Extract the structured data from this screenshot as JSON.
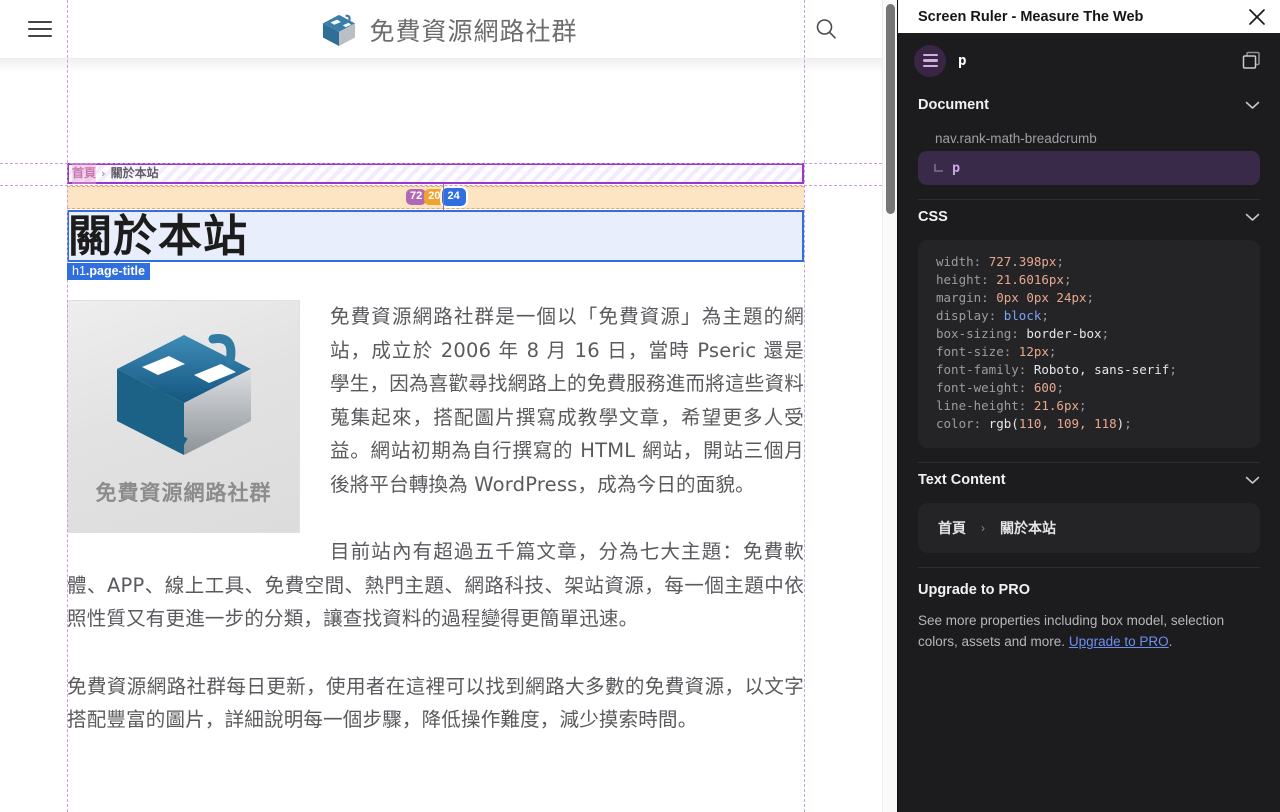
{
  "webpage": {
    "header": {
      "menu_icon": "hamburger-icon",
      "brand_text": "免費資源網路社群",
      "search_icon": "search-icon"
    },
    "breadcrumb": {
      "home": "首頁",
      "separator": "›",
      "current": "關於本站"
    },
    "measurements": {
      "purple": "72",
      "orange": "20",
      "blue": "24"
    },
    "title": "關於本站",
    "element_tag": {
      "tag": "h1",
      "class": ".page-title"
    },
    "logo_caption": "免費資源網路社群",
    "paragraphs": [
      "免費資源網路社群是一個以「免費資源」為主題的網站，成立於 2006 年 8 月 16 日，當時 Pseric 還是學生，因為喜歡尋找網路上的免費服務進而將這些資料蒐集起來，搭配圖片撰寫成教學文章，希望更多人受益。網站初期為自行撰寫的 HTML 網站，開站三個月後將平台轉換為 WordPress，成為今日的面貌。",
      "目前站內有超過五千篇文章，分為七大主題：免費軟體、APP、線上工具、免費空間、熱門主題、網路科技、架站資源，每一個主題中依照性質又有更進一步的分類，讓查找資料的過程變得更簡單迅速。",
      "免費資源網路社群每日更新，使用者在這裡可以找到網路大多數的免費資源，以文字搭配豐富的圖片，詳細說明每一個步驟，降低操作難度，減少摸索時間。"
    ]
  },
  "panel": {
    "title": "Screen Ruler - Measure The Web",
    "close_icon": "close-icon",
    "toolbar": {
      "avatar_icon": "menu-avatar-icon",
      "selected_element": "p",
      "copy_icon": "copy-icon"
    },
    "document": {
      "heading": "Document",
      "chevron_icon": "chevron-down-icon",
      "parent_node": "nav.rank-math-breadcrumb",
      "selected_node": "p"
    },
    "css": {
      "heading": "CSS",
      "chevron_icon": "chevron-down-icon",
      "properties": [
        {
          "name": "width",
          "value": "727.398px",
          "kind": "num"
        },
        {
          "name": "height",
          "value": "21.6016px",
          "kind": "num"
        },
        {
          "name": "margin",
          "value": "0px 0px 24px",
          "kind": "num"
        },
        {
          "name": "display",
          "value": "block",
          "kind": "kw"
        },
        {
          "name": "box-sizing",
          "value": "border-box",
          "kind": "word"
        },
        {
          "name": "font-size",
          "value": "12px",
          "kind": "num"
        },
        {
          "name": "font-family",
          "value": "Roboto, sans-serif",
          "kind": "word"
        },
        {
          "name": "font-weight",
          "value": "600",
          "kind": "num"
        },
        {
          "name": "line-height",
          "value": "21.6px",
          "kind": "num"
        },
        {
          "name": "color",
          "value": "rgb(110, 109, 118)",
          "kind": "func"
        }
      ]
    },
    "text_content": {
      "heading": "Text Content",
      "chevron_icon": "chevron-down-icon",
      "value_home": "首頁",
      "value_sep": "›",
      "value_current": "關於本站"
    },
    "upgrade": {
      "heading": "Upgrade to PRO",
      "body_before": "See more properties including box model, selection colors, assets and more. ",
      "link": "Upgrade to PRO",
      "body_after": "."
    }
  },
  "colors": {
    "panel_bg": "#1c1c1e",
    "panel_card": "#242427",
    "accent_purple": "#c9a6e8",
    "selected_blue": "#2f6fe0",
    "breadcrumb_purple": "#9b38c9",
    "margin_orange": "#fde3c0",
    "link_blue": "#6e8ff0"
  }
}
